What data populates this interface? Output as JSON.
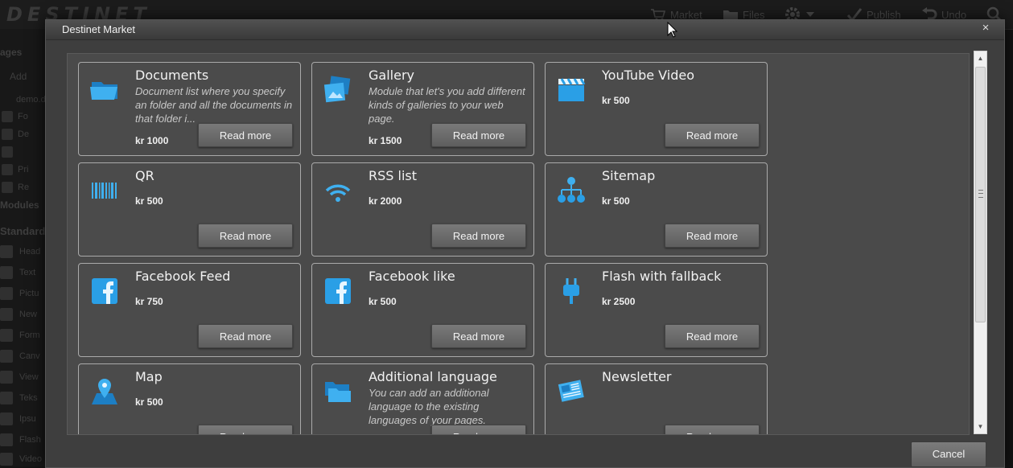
{
  "background_app": {
    "logo": "DESTINET",
    "toolbar": [
      {
        "label": "Market",
        "icon": "cart-icon"
      },
      {
        "label": "Files",
        "icon": "folder-icon"
      },
      {
        "label": "",
        "icon": "gear-icon"
      },
      {
        "label": "Publish",
        "icon": "check-icon"
      },
      {
        "label": "Undo",
        "icon": "undo-icon"
      },
      {
        "label": "",
        "icon": "search-icon"
      }
    ],
    "sidebar": {
      "pages_heading": "ages",
      "add_label": "Add",
      "site_label": "demo.d",
      "tree_items": [
        "Fo",
        "De",
        "",
        "Pri",
        "Re"
      ],
      "modules_heading": "Modules",
      "standard_heading": "Standard",
      "module_items": [
        "Head",
        "Text",
        "Pictu",
        "New",
        "Form",
        "Canv",
        "View",
        "Teks",
        "Ipsu",
        "Flash",
        "Video"
      ]
    }
  },
  "modal": {
    "title": "Destinet Market",
    "close_label": "×",
    "cancel_label": "Cancel",
    "read_more_label": "Read more",
    "tiles": [
      {
        "title": "Documents",
        "description": "Document list where you specify an folder and all the documents in that folder i...",
        "price": "kr 1000",
        "icon": "folder-icon"
      },
      {
        "title": "Gallery",
        "description": "Module that let's you add different kinds of galleries to your web page.",
        "price": "kr 1500",
        "icon": "gallery-icon"
      },
      {
        "title": "YouTube Video",
        "description": "",
        "price": "kr 500",
        "icon": "clapperboard-icon"
      },
      {
        "title": "QR",
        "description": "",
        "price": "kr 500",
        "icon": "barcode-icon"
      },
      {
        "title": "RSS list",
        "description": "",
        "price": "kr 2000",
        "icon": "wifi-icon"
      },
      {
        "title": "Sitemap",
        "description": "",
        "price": "kr 500",
        "icon": "sitemap-icon"
      },
      {
        "title": "Facebook Feed",
        "description": "",
        "price": "kr 750",
        "icon": "facebook-icon"
      },
      {
        "title": "Facebook like",
        "description": "",
        "price": "kr 500",
        "icon": "facebook-icon"
      },
      {
        "title": "Flash with fallback",
        "description": "",
        "price": "kr 2500",
        "icon": "plug-icon"
      },
      {
        "title": "Map",
        "description": "",
        "price": "kr 500",
        "icon": "map-pin-icon"
      },
      {
        "title": "Additional language",
        "description": "You can add an additional language to the existing languages of your pages.",
        "price": "",
        "icon": "folders-icon"
      },
      {
        "title": "Newsletter",
        "description": "",
        "price": "",
        "icon": "newspaper-icon"
      }
    ]
  },
  "colors": {
    "modal_bg": "#3e3e3e",
    "body_bg": "#4a4a4a",
    "tile_border": "#aaaaaa",
    "icon_blue": "#2a9fe6"
  }
}
